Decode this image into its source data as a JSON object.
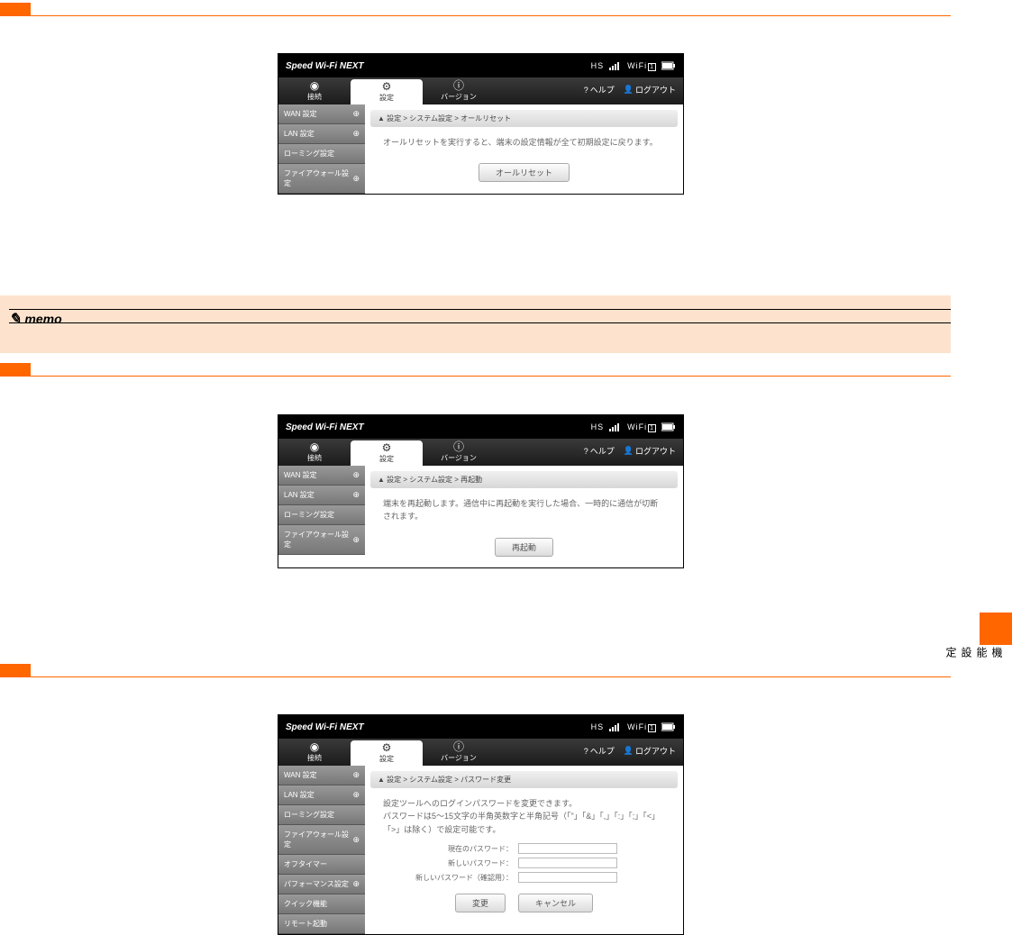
{
  "memo_label": "memo",
  "side_tab_text": "機能設定",
  "router_common": {
    "brand": "Speed Wi-Fi NEXT",
    "hs": "HS",
    "wifi_label": "WiFi",
    "tabs": {
      "connect": "接続",
      "settings": "設定",
      "version": "バージョン"
    },
    "side_items": [
      "WAN 設定",
      "LAN 設定",
      "ローミング設定",
      "ファイアウォール設定"
    ],
    "side_items_ext": [
      "WAN 設定",
      "LAN 設定",
      "ローミング設定",
      "ファイアウォール設定",
      "オフタイマー",
      "パフォーマンス設定",
      "クイック機能",
      "リモート起動"
    ],
    "help": "ヘルプ",
    "logout": "ログアウト"
  },
  "shot1": {
    "crumb": "設定 > システム設定 > オールリセット",
    "desc": "オールリセットを実行すると、端末の設定情報が全て初期設定に戻ります。",
    "button": "オールリセット"
  },
  "shot2": {
    "crumb": "設定 > システム設定 > 再起動",
    "desc": "端末を再起動します。通信中に再起動を実行した場合、一時的に通信が切断されます。",
    "button": "再起動"
  },
  "shot3": {
    "crumb": "設定 > システム設定 > パスワード変更",
    "desc1": "設定ツールへのログインパスワードを変更できます。",
    "desc2": "パスワードは5～15文字の半角英数字と半角記号（「\"」「&」「,」「:」「;」「<」「>」は除く）で設定可能です。",
    "labels": {
      "current": "現在のパスワード：",
      "newpw": "新しいパスワード：",
      "confirm": "新しいパスワード（確認用）："
    },
    "btn_apply": "変更",
    "btn_cancel": "キャンセル"
  }
}
